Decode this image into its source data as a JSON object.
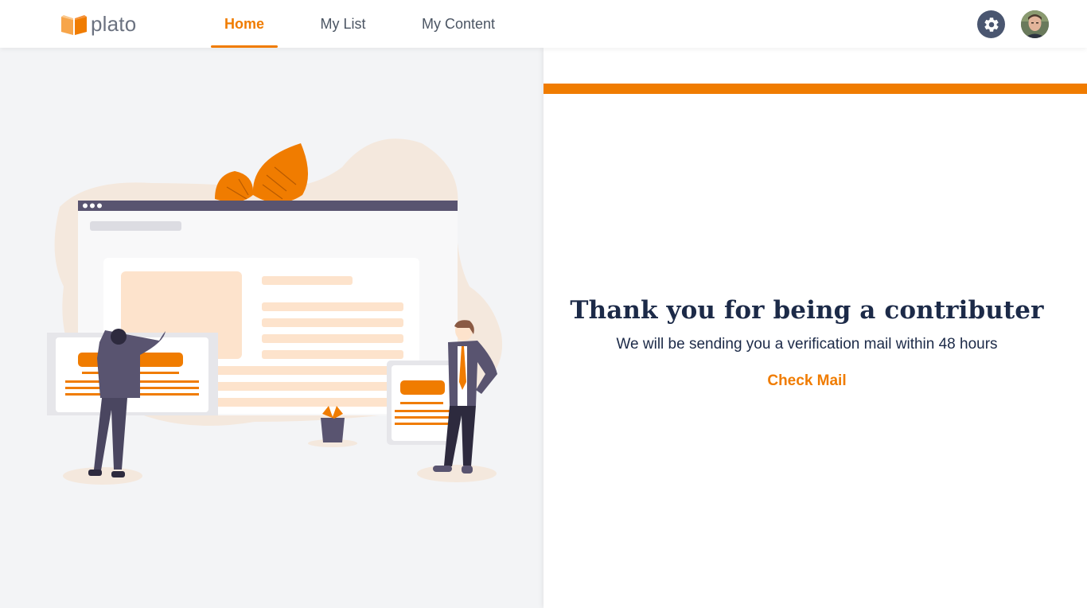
{
  "brand": {
    "name": "plato",
    "accent_color": "#f07c00",
    "mark_icon": "book-icon"
  },
  "nav": {
    "tabs": [
      {
        "label": "Home",
        "active": true
      },
      {
        "label": "My List",
        "active": false
      },
      {
        "label": "My Content",
        "active": false
      }
    ]
  },
  "header_actions": {
    "settings_icon": "gear-icon",
    "avatar_icon": "user-avatar"
  },
  "main": {
    "title": "Thank you for being a contributer",
    "subtitle": "We will be sending you a verification mail within 48 hours",
    "action_label": "Check Mail"
  },
  "colors": {
    "accent": "#f07c00",
    "heading": "#1c2a48",
    "panel_bg": "#f3f4f6"
  }
}
